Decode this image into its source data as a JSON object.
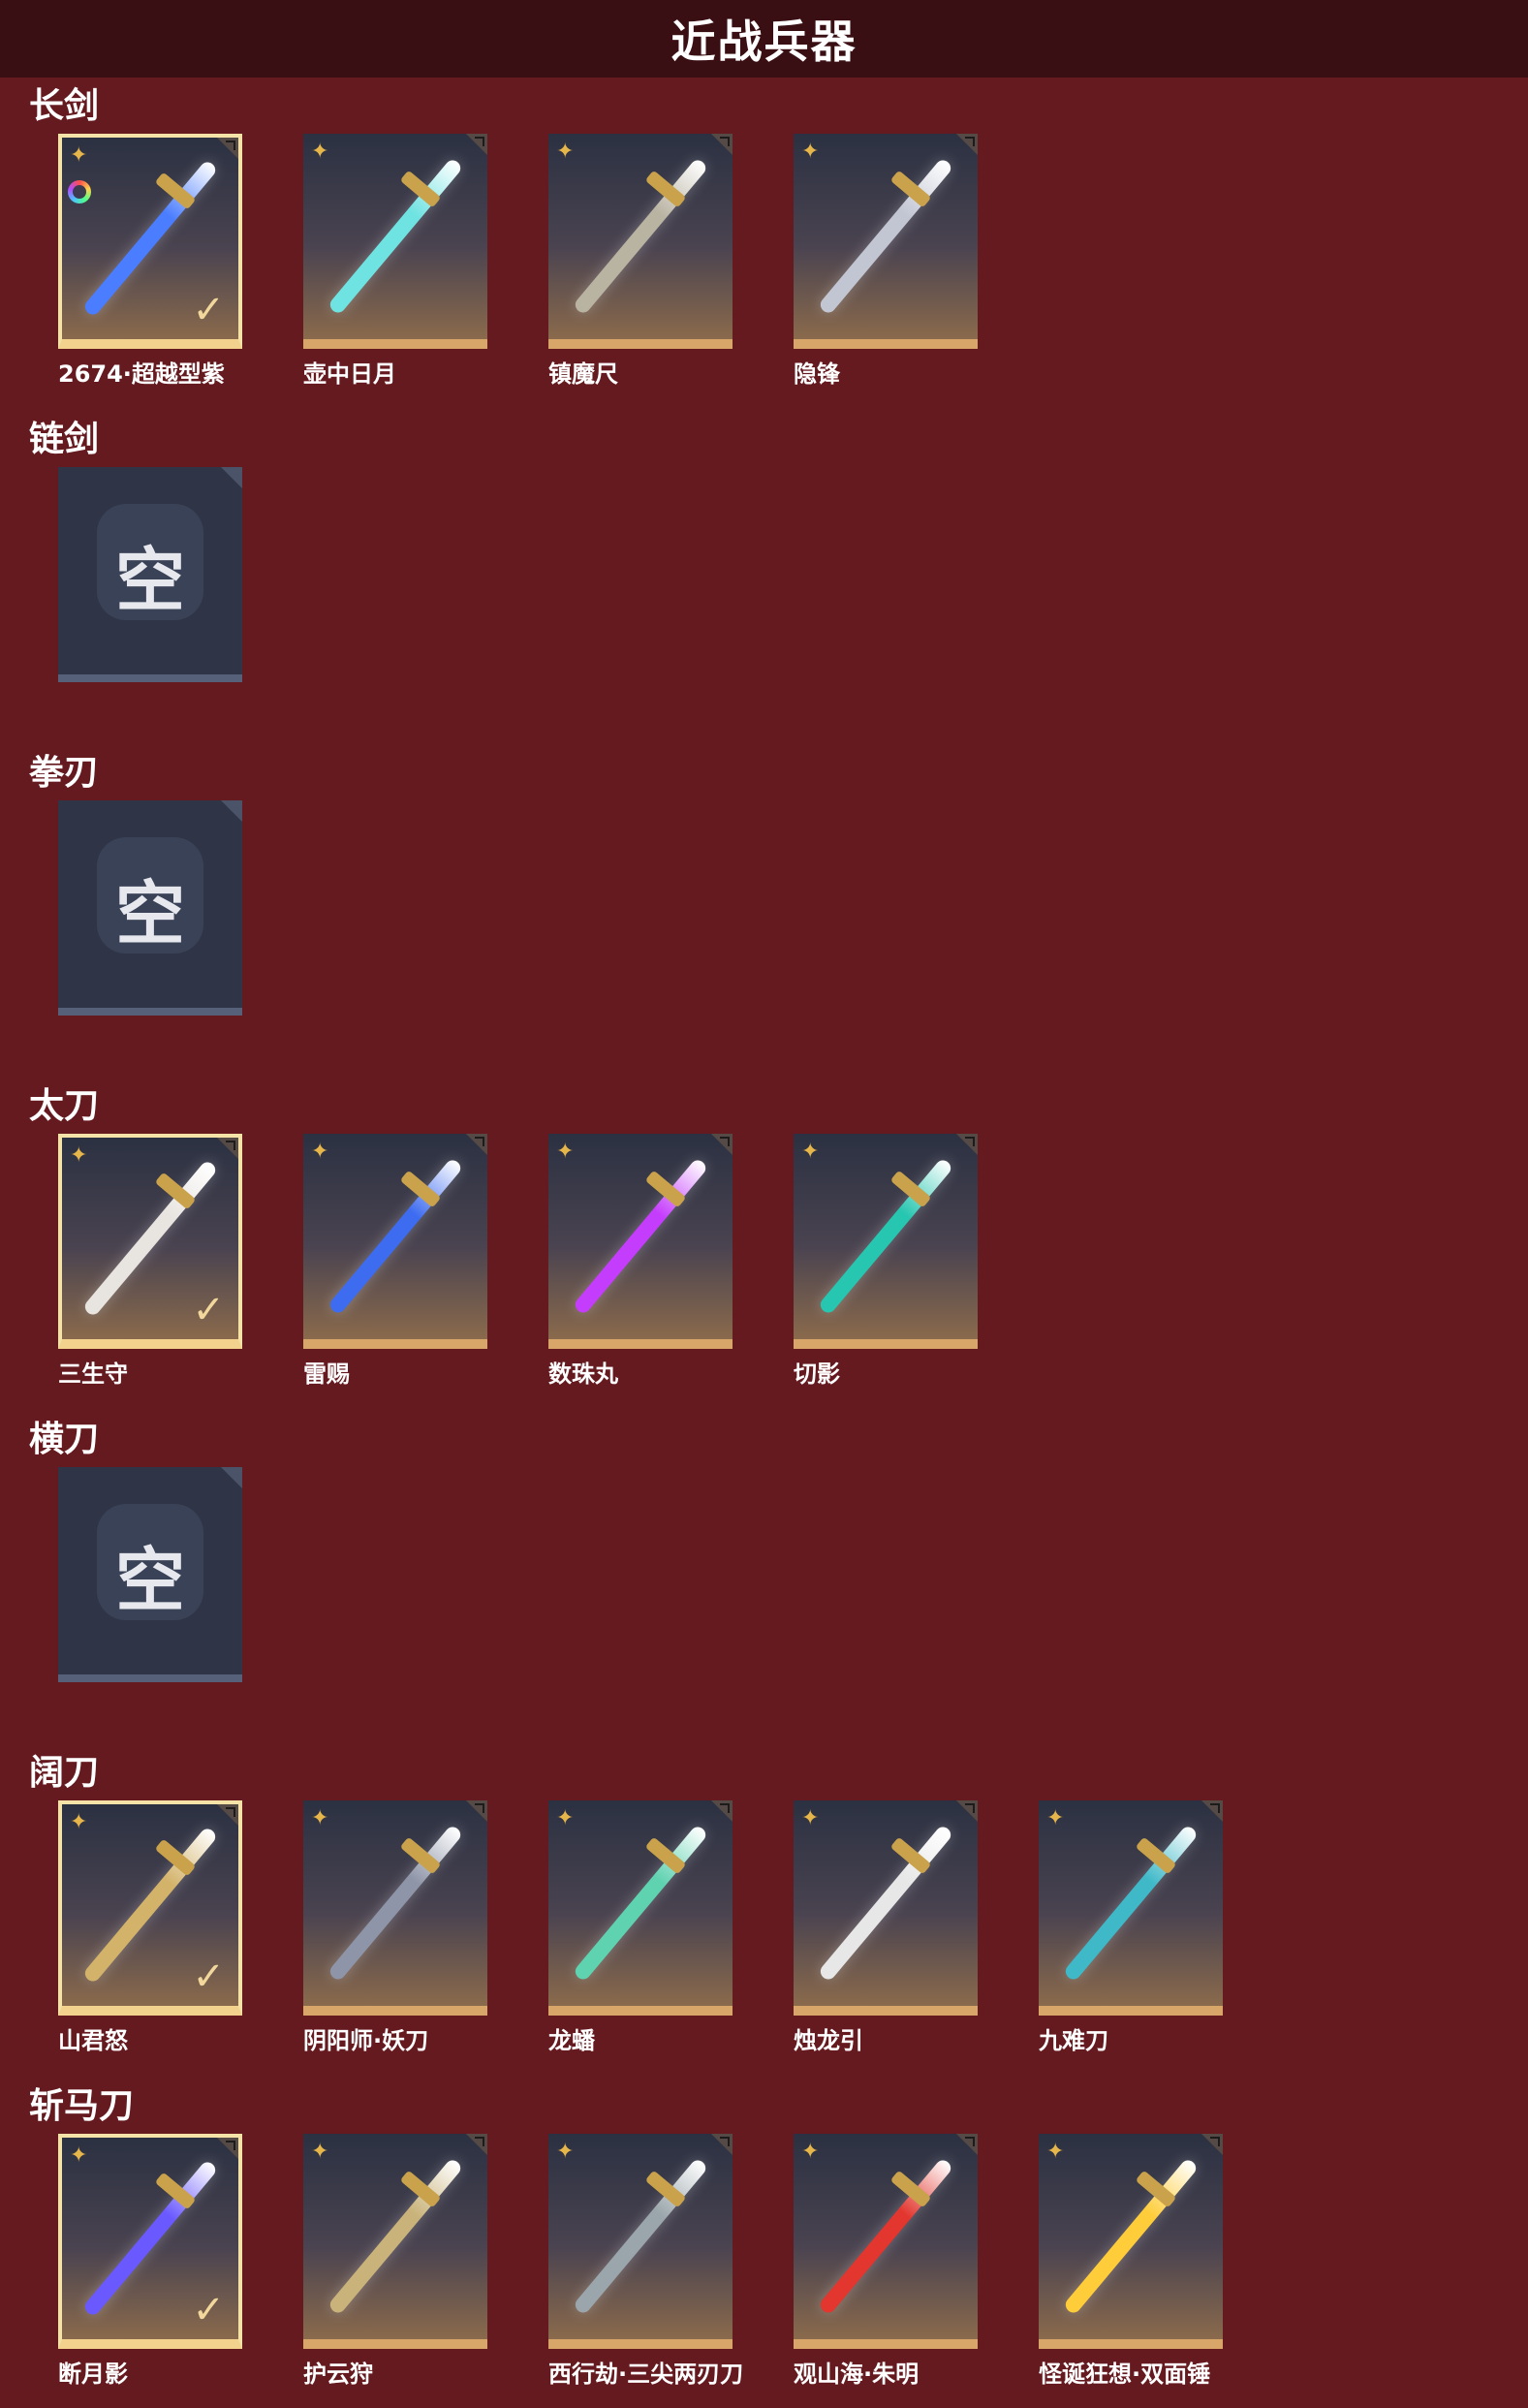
{
  "header": {
    "title": "近战兵器"
  },
  "sections": [
    {
      "label": "长剑",
      "items": [
        {
          "name": "2674·超越型紫",
          "selected": true,
          "rainbow": true,
          "color": "#4a7dff"
        },
        {
          "name": "壶中日月",
          "selected": false,
          "color": "#6fe3e1"
        },
        {
          "name": "镇魔尺",
          "selected": false,
          "color": "#b9b3a2"
        },
        {
          "name": "隐锋",
          "selected": false,
          "color": "#c2c6d3"
        }
      ]
    },
    {
      "label": "链剑",
      "empty_text": "空"
    },
    {
      "label": "拳刃",
      "empty_text": "空"
    },
    {
      "label": "太刀",
      "items": [
        {
          "name": "三生守",
          "selected": true,
          "color": "#e8e4e0"
        },
        {
          "name": "雷赐",
          "selected": false,
          "color": "#3e6cf0"
        },
        {
          "name": "数珠丸",
          "selected": false,
          "color": "#c53dfc"
        },
        {
          "name": "切影",
          "selected": false,
          "color": "#27c6b0"
        }
      ]
    },
    {
      "label": "横刀",
      "empty_text": "空"
    },
    {
      "label": "阔刀",
      "items": [
        {
          "name": "山君怒",
          "selected": true,
          "color": "#d3b36a"
        },
        {
          "name": "阴阳师·妖刀",
          "selected": false,
          "color": "#8e95a8"
        },
        {
          "name": "龙蟠",
          "selected": false,
          "color": "#5fd2b0"
        },
        {
          "name": "烛龙引",
          "selected": false,
          "color": "#e7e7e7"
        },
        {
          "name": "九难刀",
          "selected": false,
          "color": "#3fb9c8"
        }
      ]
    },
    {
      "label": "斩马刀",
      "items": [
        {
          "name": "断月影",
          "selected": true,
          "color": "#6a59ff"
        },
        {
          "name": "护云狩",
          "selected": false,
          "color": "#c9b37a"
        },
        {
          "name": "西行劫·三尖两刃刀",
          "selected": false,
          "color": "#9aa6ab"
        },
        {
          "name": "观山海·朱明",
          "selected": false,
          "color": "#e2362e"
        },
        {
          "name": "怪诞狂想·双面锤",
          "selected": false,
          "color": "#ffcd3a"
        }
      ]
    }
  ],
  "icons": {
    "star": "four-point-star-icon",
    "check": "checkmark-icon",
    "corner": "corner-tab-icon"
  }
}
